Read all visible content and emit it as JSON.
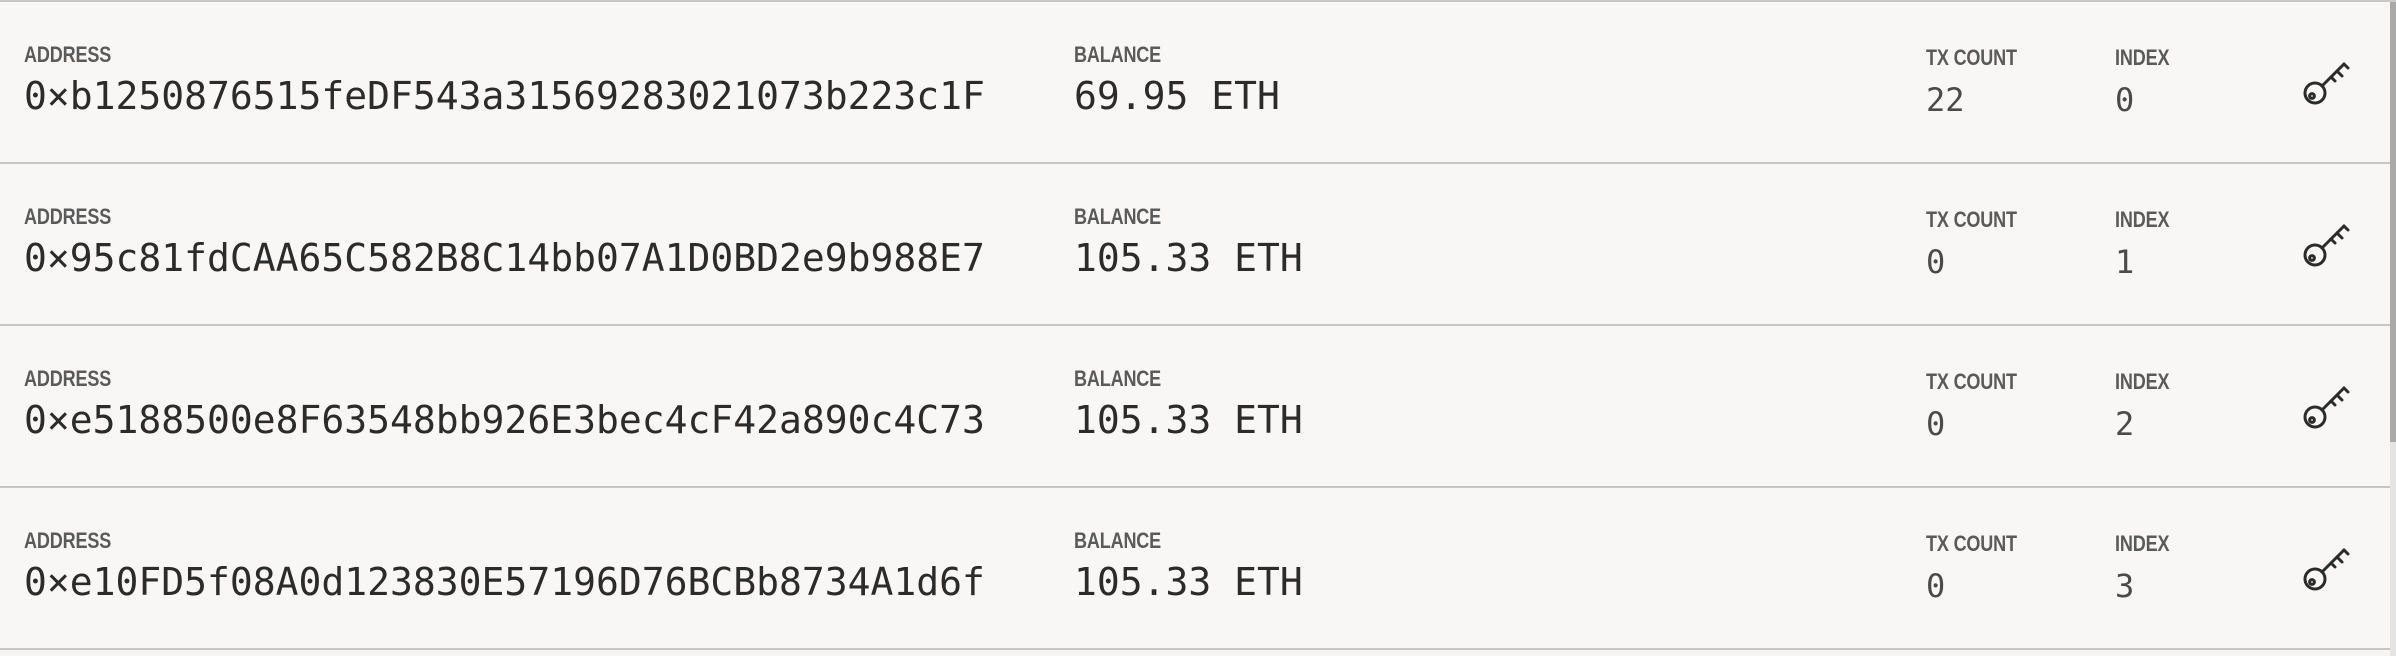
{
  "labels": {
    "address": "ADDRESS",
    "balance": "BALANCE",
    "tx_count": "TX COUNT",
    "index": "INDEX"
  },
  "accounts": [
    {
      "address": "0×b1250876515feDF543a31569283021073b223c1F",
      "balance": "69.95 ETH",
      "tx_count": "22",
      "index": "0",
      "key_icon": "key-icon"
    },
    {
      "address": "0×95c81fdCAA65C582B8C14bb07A1D0BD2e9b988E7",
      "balance": "105.33 ETH",
      "tx_count": "0",
      "index": "1",
      "key_icon": "key-icon"
    },
    {
      "address": "0×e5188500e8F63548bb926E3bec4cF42a890c4C73",
      "balance": "105.33 ETH",
      "tx_count": "0",
      "index": "2",
      "key_icon": "key-icon"
    },
    {
      "address": "0×e10FD5f08A0d123830E57196D76BCBb8734A1d6f",
      "balance": "105.33 ETH",
      "tx_count": "0",
      "index": "3",
      "key_icon": "key-icon"
    }
  ],
  "colors": {
    "background": "#f8f7f5",
    "divider": "#c6c6c6",
    "label": "#5a5a5a",
    "value": "#2b2b2b"
  }
}
